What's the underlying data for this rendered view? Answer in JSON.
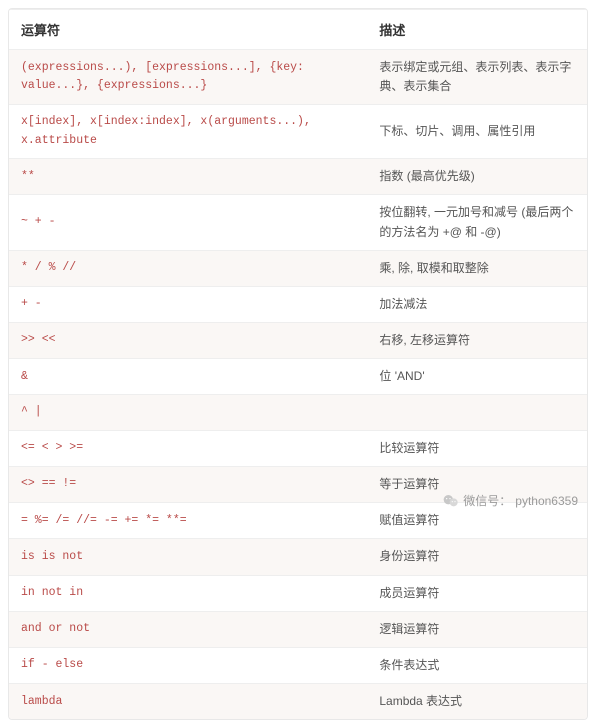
{
  "header": {
    "col1": "运算符",
    "col2": "描述"
  },
  "rows": [
    {
      "op": "(expressions...), [expressions...], {key: value...}, {expressions...}",
      "desc": "表示绑定或元组、表示列表、表示字典、表示集合"
    },
    {
      "op": "x[index], x[index:index], x(arguments...), x.attribute",
      "desc": "下标、切片、调用、属性引用"
    },
    {
      "op": "**",
      "desc": "指数 (最高优先级)"
    },
    {
      "op": "~ + -",
      "desc": "按位翻转, 一元加号和减号 (最后两个的方法名为 +@ 和 -@)"
    },
    {
      "op": "* / % //",
      "desc": "乘, 除, 取模和取整除"
    },
    {
      "op": "+ -",
      "desc": "加法减法"
    },
    {
      "op": ">> <<",
      "desc": "右移, 左移运算符"
    },
    {
      "op": "&",
      "desc": "位 'AND'"
    },
    {
      "op": "^ |",
      "desc": ""
    },
    {
      "op": "<= < > >=",
      "desc": "比较运算符"
    },
    {
      "op": "<> == !=",
      "desc": "等于运算符"
    },
    {
      "op": "= %= /= //= -= += *= **=",
      "desc": "赋值运算符"
    },
    {
      "op": "is is not",
      "desc": "身份运算符"
    },
    {
      "op": "in not in",
      "desc": "成员运算符"
    },
    {
      "op": "and or not",
      "desc": "逻辑运算符"
    },
    {
      "op": "if - else",
      "desc": "条件表达式"
    },
    {
      "op": "lambda",
      "desc": "Lambda 表达式"
    }
  ],
  "watermark": {
    "label": "微信号：",
    "id": "python6359"
  }
}
